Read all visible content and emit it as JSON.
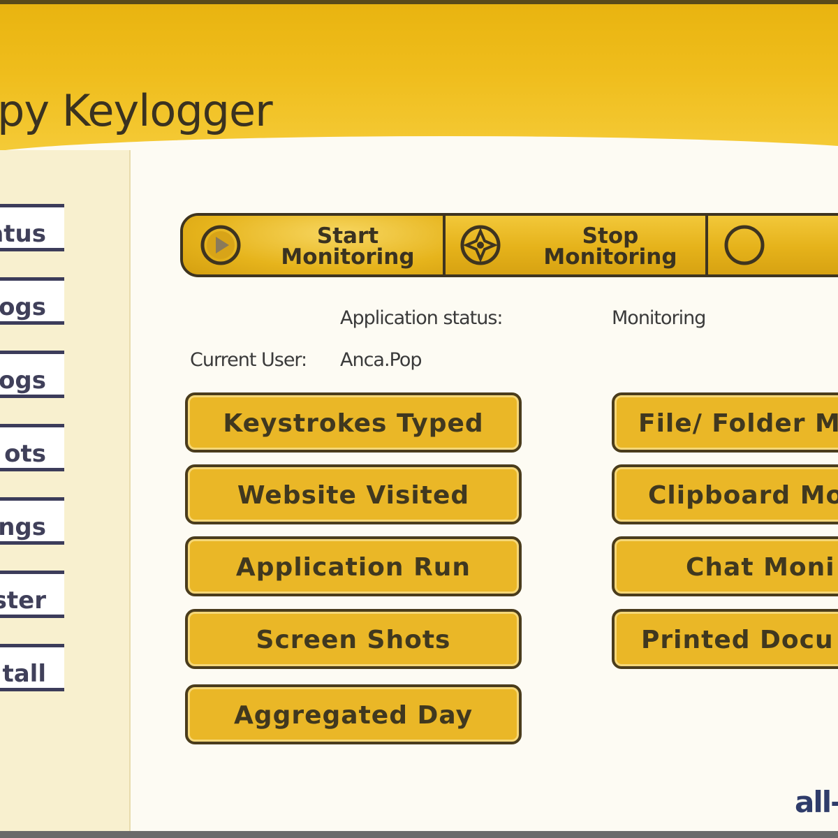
{
  "app": {
    "title": "py Keylogger"
  },
  "sidebar": {
    "items": [
      {
        "label": "atus"
      },
      {
        "label": "ogs"
      },
      {
        "label": "ogs"
      },
      {
        "label": "ots"
      },
      {
        "label": "ngs"
      },
      {
        "label": "ster"
      },
      {
        "label": "tall"
      }
    ]
  },
  "toolbar": {
    "start_label": "Start\nMonitoring",
    "stop_label": "Stop\nMonitoring",
    "play_icon": "play-icon",
    "stop_icon": "stop-icon",
    "third_icon": "circle-icon"
  },
  "status": {
    "app_status_label": "Application status:",
    "app_status_value": "Monitoring",
    "user_label": "Current User:",
    "user_value": "Anca.Pop"
  },
  "features": {
    "left": [
      {
        "label": "Keystrokes Typed"
      },
      {
        "label": "Website Visited"
      },
      {
        "label": "Application Run"
      },
      {
        "label": "Screen Shots"
      },
      {
        "label": "Aggregated Day"
      }
    ],
    "right": [
      {
        "label": "File/ Folder Mo"
      },
      {
        "label": "Clipboard Mo"
      },
      {
        "label": "Chat Moni"
      },
      {
        "label": "Printed Docu"
      }
    ]
  },
  "watermark": "all-",
  "colors": {
    "header": "#efbd1c",
    "button": "#eab727",
    "nav_border": "#3c3c5a"
  }
}
